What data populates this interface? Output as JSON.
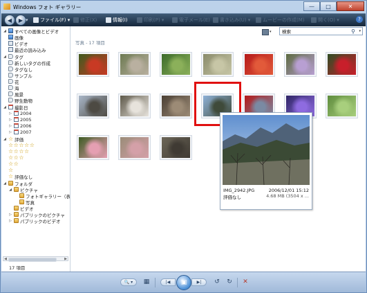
{
  "window": {
    "title": "Windows フォト ギャラリー"
  },
  "caption": {
    "minimize": "—",
    "maximize": "□",
    "close": "✕"
  },
  "toolbar": {
    "back": "◀",
    "forward": "▶",
    "nav_drop": "▾",
    "file": "ファイル(F) ▾",
    "fix": "修正(X)",
    "info": "情報(I)",
    "print": "印刷(P) ▾",
    "email": "電子メール(E)",
    "burn": "書き込み(U) ▾",
    "movie": "ムービーの作成(M)",
    "open": "開く(O) ▾",
    "help": "?"
  },
  "sidebar": {
    "items": [
      {
        "label": "すべての画像とビデオ",
        "icon": "photo-library-icon"
      },
      {
        "label": "画像",
        "icon": "image-icon"
      },
      {
        "label": "ビデオ",
        "icon": "video-icon"
      },
      {
        "label": "最近の読み込み",
        "icon": "recent-import-icon"
      },
      {
        "label": "タグ",
        "icon": "tag-icon"
      },
      {
        "label": "新しいタグの作成",
        "icon": "new-tag-icon"
      },
      {
        "label": "タグなし",
        "icon": "tag-icon"
      },
      {
        "label": "サンプル",
        "icon": "tag-icon"
      },
      {
        "label": "花",
        "icon": "tag-icon"
      },
      {
        "label": "海",
        "icon": "tag-icon"
      },
      {
        "label": "風景",
        "icon": "tag-icon"
      },
      {
        "label": "野生動物",
        "icon": "tag-icon"
      },
      {
        "label": "撮影日",
        "icon": "calendar-icon"
      },
      {
        "label": "2004",
        "icon": "calendar-icon"
      },
      {
        "label": "2005",
        "icon": "calendar-icon"
      },
      {
        "label": "2006",
        "icon": "calendar-icon"
      },
      {
        "label": "2007",
        "icon": "calendar-icon"
      },
      {
        "label": "評価",
        "icon": "star-icon"
      },
      {
        "label": "☆☆☆☆☆",
        "icon": ""
      },
      {
        "label": "☆☆☆☆",
        "icon": ""
      },
      {
        "label": "☆☆☆",
        "icon": ""
      },
      {
        "label": "☆☆",
        "icon": ""
      },
      {
        "label": "☆",
        "icon": ""
      },
      {
        "label": "評価なし",
        "icon": "no-rating-icon"
      },
      {
        "label": "フォルダ",
        "icon": "folder-icon"
      },
      {
        "label": "ピクチャ",
        "icon": "folder-icon"
      },
      {
        "label": "フォトギャラリー（表示",
        "icon": "folder-icon"
      },
      {
        "label": "写真",
        "icon": "folder-icon"
      },
      {
        "label": "ビデオ",
        "icon": "folder-icon"
      },
      {
        "label": "パブリックのピクチャ",
        "icon": "folder-icon"
      },
      {
        "label": "パブリックのビデオ",
        "icon": "folder-icon"
      }
    ],
    "count": "17 項目"
  },
  "main": {
    "view_control": "▾",
    "search_placeholder": "検索",
    "group_header": "写真 - 17 項目",
    "thumbnails": [
      {
        "subject": "red-berries",
        "c1": "#3f5a1e",
        "c2": "#c83a24"
      },
      {
        "subject": "flowers-branch",
        "c1": "#6d7a52",
        "c2": "#b9b0a0"
      },
      {
        "subject": "green-leaves",
        "c1": "#3c6b2a",
        "c2": "#8bb05a"
      },
      {
        "subject": "dry-grass",
        "c1": "#8a8b6b",
        "c2": "#c7c6a6"
      },
      {
        "subject": "red-flowers",
        "c1": "#b51a1a",
        "c2": "#e25a3a"
      },
      {
        "subject": "purple-flowers",
        "c1": "#5c6a3f",
        "c2": "#b89fd2"
      },
      {
        "subject": "red-camellia",
        "c1": "#2f4d24",
        "c2": "#c81f2b"
      },
      {
        "subject": "bare-tree",
        "c1": "#a9b7c9",
        "c2": "#4d4a43"
      },
      {
        "subject": "white-flower",
        "c1": "#5f5a4b",
        "c2": "#e7e3dc"
      },
      {
        "subject": "pine-cone",
        "c1": "#4a3f34",
        "c2": "#9c8b76"
      },
      {
        "subject": "mountain-view",
        "c1": "#8fb2d8",
        "c2": "#3f4a3a"
      },
      {
        "subject": "red-berries-branch",
        "c1": "#b51818",
        "c2": "#7a8aa3"
      },
      {
        "subject": "purple-pansy",
        "c1": "#2f2566",
        "c2": "#8e6be0"
      },
      {
        "subject": "green-bud",
        "c1": "#5f8c3d",
        "c2": "#a8cf7d"
      },
      {
        "subject": "pink-buds",
        "c1": "#3d5b23",
        "c2": "#e59fb2"
      },
      {
        "subject": "pink-blossom",
        "c1": "#9a8c78",
        "c2": "#d4a0a8"
      },
      {
        "subject": "pine-cone-2",
        "c1": "#6c6658",
        "c2": "#3f3a33"
      }
    ],
    "preview": {
      "filename": "IMG_2942.JPG",
      "date": "2006/12/01  15:12",
      "rating": "評価なし",
      "size": "4.68 MB (3504 x ..."
    }
  },
  "bottom": {
    "zoom": "🔍 ▾",
    "grid": "▦",
    "prev": "|◀",
    "slideshow": "▣",
    "next": "▶|",
    "rotate_left": "↺",
    "rotate_right": "↻",
    "delete": "✕"
  },
  "colors": {
    "selection": "#e01010",
    "toolbar_bg": "#1e334a",
    "chrome": "#bcd2ea"
  }
}
